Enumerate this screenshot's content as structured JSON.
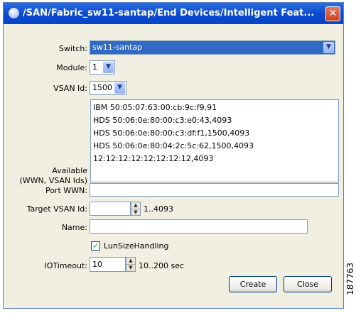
{
  "window": {
    "title": "/SAN/Fabric_sw11-santap/End Devices/Intelligent Feat...",
    "close_glyph": "✕"
  },
  "form": {
    "switch_label": "Switch:",
    "switch_value": "sw11-santap",
    "module_label": "Module:",
    "module_value": "1",
    "vsan_label": "VSAN Id:",
    "vsan_value": "1500",
    "available_label_line1": "Available",
    "available_label_line2": "(WWN, VSAN Ids)",
    "available_items": [
      "IBM 50:05:07:63:00:cb:9c:f9,91",
      "HDS 50:06:0e:80:00:c3:e0:43,4093",
      "HDS 50:06:0e:80:00:c3:df:f1,1500,4093",
      "HDS 50:06:0e:80:04:2c:5c:62,1500,4093",
      "12:12:12:12:12:12:12:12,4093"
    ],
    "port_wwn_label": "Port WWN:",
    "port_wwn_value": "",
    "target_vsan_label": "Target VSAN Id:",
    "target_vsan_value": "",
    "target_vsan_range": "1..4093",
    "name_label": "Name:",
    "name_value": "",
    "lun_checkbox_label": "LunSizeHandling",
    "lun_checked": true,
    "iotimeout_label": "IOTimeout:",
    "iotimeout_value": "10",
    "iotimeout_range": "10..200 sec"
  },
  "buttons": {
    "create": "Create",
    "close": "Close"
  },
  "watermark": "187763"
}
